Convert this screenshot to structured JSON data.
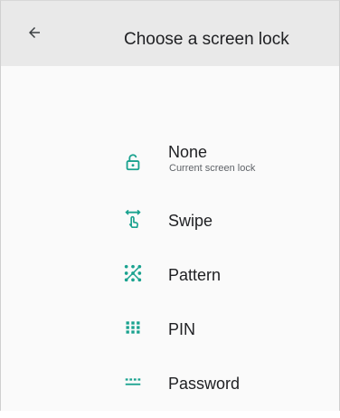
{
  "colors": {
    "accent": "#1aa28f",
    "appbar_bg": "#e9e9e9",
    "text": "#202124",
    "subtext": "#5f6368"
  },
  "appbar": {
    "back_icon": "arrow-back-icon",
    "title": "Choose a screen lock"
  },
  "options": [
    {
      "id": "none",
      "label": "None",
      "sublabel": "Current screen lock",
      "icon": "unlocked-padlock-icon"
    },
    {
      "id": "swipe",
      "label": "Swipe",
      "icon": "swipe-hand-icon"
    },
    {
      "id": "pattern",
      "label": "Pattern",
      "icon": "pattern-dots-icon"
    },
    {
      "id": "pin",
      "label": "PIN",
      "icon": "pin-keypad-icon"
    },
    {
      "id": "password",
      "label": "Password",
      "icon": "password-icon"
    }
  ]
}
